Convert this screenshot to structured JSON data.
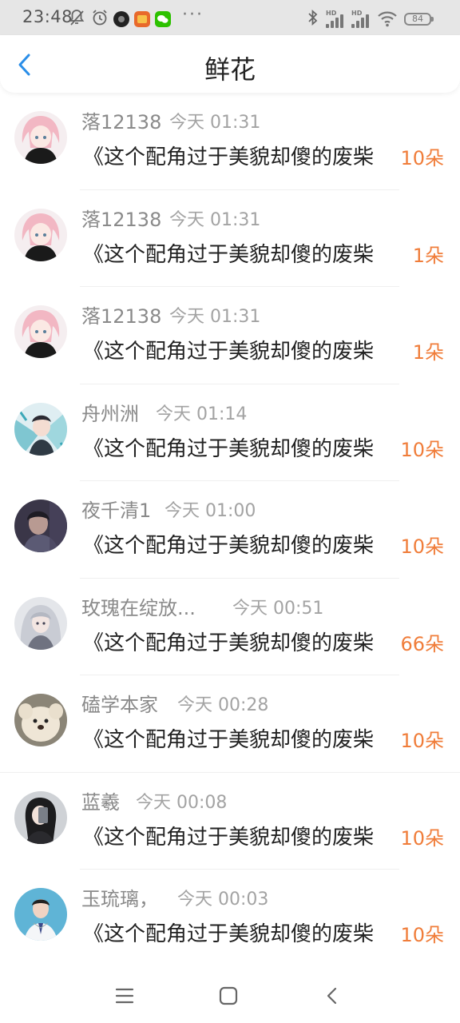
{
  "status_bar": {
    "time": "23:48",
    "battery": "84",
    "icons": [
      "mute-bell-icon",
      "alarm-icon",
      "camera-app-icon",
      "taobao-app-icon",
      "wechat-app-icon",
      "more-dots-icon",
      "bluetooth-icon",
      "hd-signal-icon",
      "hd-signal-icon",
      "wifi-icon",
      "battery-icon"
    ]
  },
  "header": {
    "title": "鲜花",
    "back_icon": "chevron-left-icon"
  },
  "colors": {
    "accent_back": "#2a8ee8",
    "count_orange": "#f07d3a",
    "meta_gray": "#8a8a8a"
  },
  "rows": [
    {
      "name": "落12138",
      "time": "今天 01:31",
      "message": "《这个配角过于美貌却傻的废柴",
      "count": "10朵",
      "avatar": "pink-hair-anime-girl"
    },
    {
      "name": "落12138",
      "time": "今天 01:31",
      "message": "《这个配角过于美貌却傻的废柴",
      "count": "1朵",
      "avatar": "pink-hair-anime-girl"
    },
    {
      "name": "落12138",
      "time": "今天 01:31",
      "message": "《这个配角过于美貌却傻的废柴",
      "count": "1朵",
      "avatar": "pink-hair-anime-girl"
    },
    {
      "name": "舟州洲",
      "time": "今天 01:14",
      "message": "《这个配角过于美貌却傻的废柴",
      "count": "10朵",
      "avatar": "anime-character-teal"
    },
    {
      "name": "夜千清1",
      "time": "今天 01:00",
      "message": "《这个配角过于美貌却傻的废柴",
      "count": "10朵",
      "avatar": "dark-photo-person"
    },
    {
      "name": "玫瑰在绽放...",
      "time": "今天 00:51",
      "message": "《这个配角过于美貌却傻的废柴",
      "count": "66朵",
      "avatar": "silver-hair-anime"
    },
    {
      "name": "磕学本家",
      "time": "今天 00:28",
      "message": "《这个配角过于美貌却傻的废柴",
      "count": "10朵",
      "avatar": "plush-dog"
    },
    {
      "name": "蓝羲",
      "time": "今天 00:08",
      "message": "《这个配角过于美貌却傻的废柴",
      "count": "10朵",
      "avatar": "selfie-person"
    },
    {
      "name": "玉琉璃，",
      "time": "今天 00:03",
      "message": "《这个配角过于美貌却傻的废柴",
      "count": "10朵",
      "avatar": "man-in-suit"
    }
  ],
  "nav": {
    "menu_icon": "menu-icon",
    "home_icon": "home-square-icon",
    "back_icon": "back-triangle-icon"
  }
}
